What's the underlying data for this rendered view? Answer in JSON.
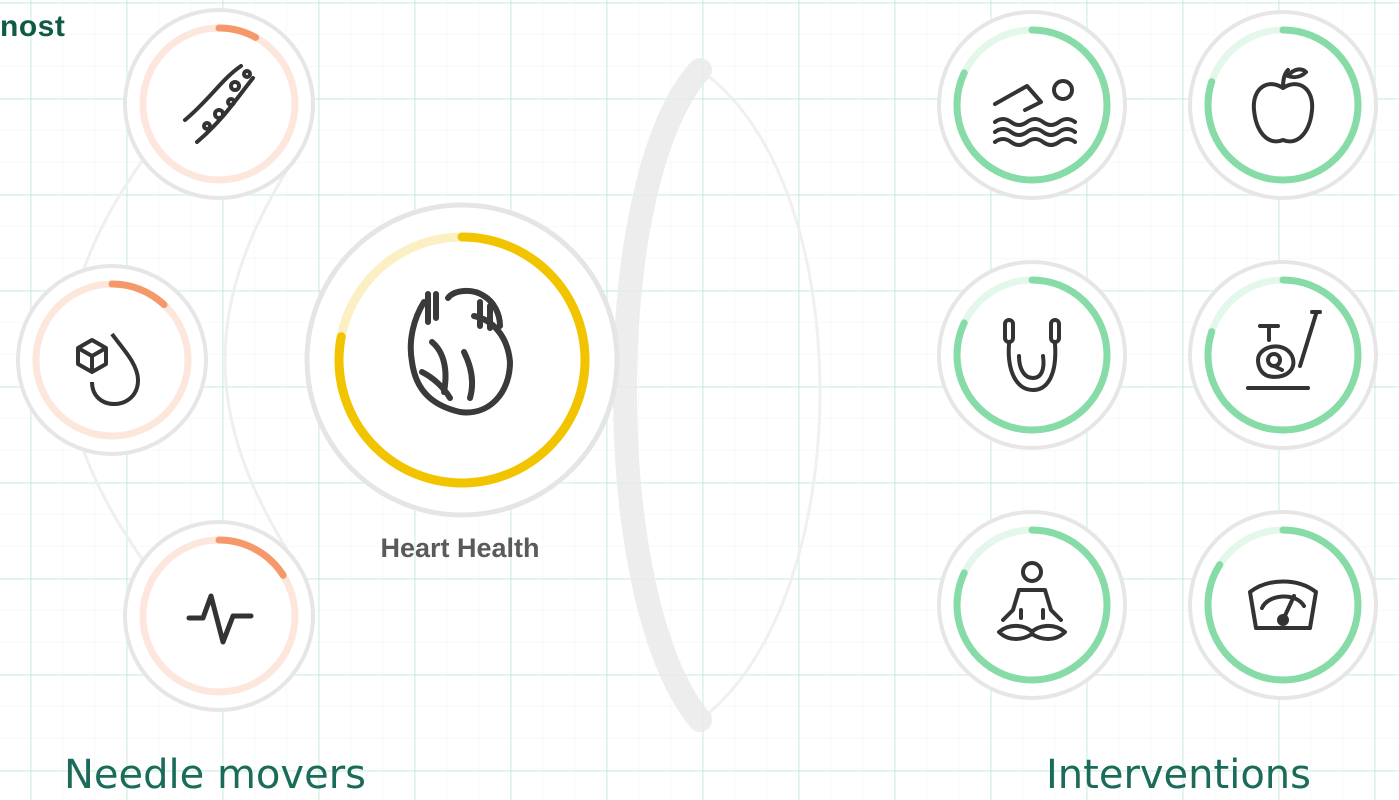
{
  "header": {
    "partial_text": "nost"
  },
  "center": {
    "label": "Heart Health",
    "icon": "heart-icon",
    "color": "#f2c400",
    "progress": 0.78
  },
  "needle_movers": {
    "caption": "Needle movers",
    "color": "#f5996a",
    "items": [
      {
        "icon": "artery-icon",
        "progress": 0.08
      },
      {
        "icon": "blood-sugar-drop-icon",
        "progress": 0.12
      },
      {
        "icon": "heart-rate-pulse-icon",
        "progress": 0.16
      }
    ]
  },
  "interventions": {
    "caption": "Interventions",
    "color": "#86dba7",
    "items": [
      {
        "icon": "swimming-icon",
        "progress": 0.82
      },
      {
        "icon": "apple-icon",
        "progress": 0.8
      },
      {
        "icon": "jump-rope-icon",
        "progress": 0.82
      },
      {
        "icon": "exercise-bike-icon",
        "progress": 0.8
      },
      {
        "icon": "meditation-icon",
        "progress": 0.82
      },
      {
        "icon": "weight-scale-icon",
        "progress": 0.84
      }
    ]
  }
}
